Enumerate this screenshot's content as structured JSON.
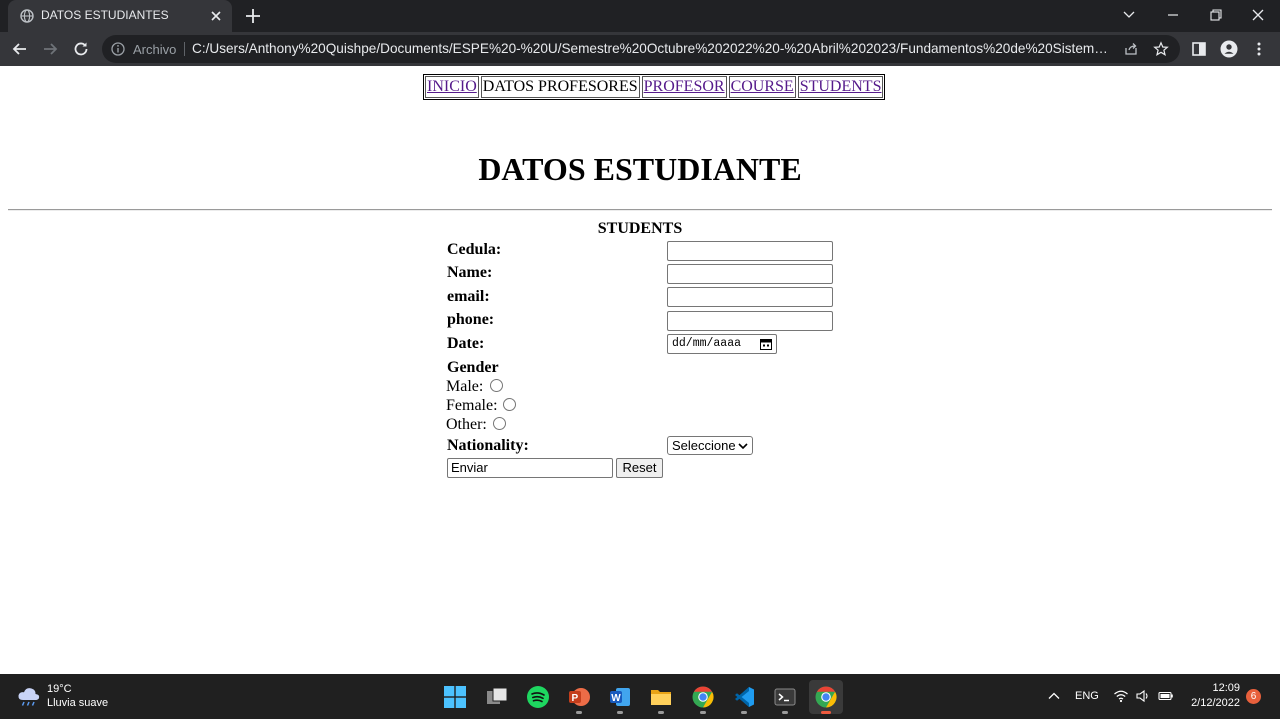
{
  "browser": {
    "tab_title": "DATOS ESTUDIANTES",
    "omnibox_label": "Archivo",
    "url": "C:/Users/Anthony%20Quishpe/Documents/ESPE%20-%20U/Semestre%20Octubre%202022%20-%20Abril%202023/Fundamentos%20de%20Sistemas%20We..."
  },
  "nav_menu": {
    "items": [
      {
        "label": "INICIO"
      },
      {
        "label": "DATOS PROFESORES"
      },
      {
        "label": "PROFESOR"
      },
      {
        "label": "COURSE"
      },
      {
        "label": "STUDENTS"
      }
    ]
  },
  "page": {
    "title": "DATOS ESTUDIANTE"
  },
  "form": {
    "caption": "STUDENTS",
    "fields": {
      "cedula": {
        "label": "Cedula:",
        "value": ""
      },
      "name": {
        "label": "Name:",
        "value": ""
      },
      "email": {
        "label": "email:",
        "value": ""
      },
      "phone": {
        "label": "phone:",
        "value": ""
      },
      "date": {
        "label": "Date:",
        "placeholder": "dd/mm/aaaa"
      }
    },
    "gender": {
      "label": "Gender",
      "options": [
        {
          "label": "Male:"
        },
        {
          "label": "Female:"
        },
        {
          "label": "Other:"
        }
      ]
    },
    "nationality": {
      "label": "Nationality:",
      "selected": "Seleccione"
    },
    "submit_label": "Enviar",
    "reset_label": "Reset"
  },
  "taskbar": {
    "weather_temp": "19°C",
    "weather_desc": "Lluvia suave",
    "language": "ENG",
    "time": "12:09",
    "date": "2/12/2022",
    "notification_count": "6"
  },
  "colors": {
    "tab_bar_bg": "#202124",
    "toolbar_bg": "#35363a",
    "visited_link": "#551a8b",
    "taskbar_bg": "#202020",
    "notification_badge": "#e8603c"
  }
}
